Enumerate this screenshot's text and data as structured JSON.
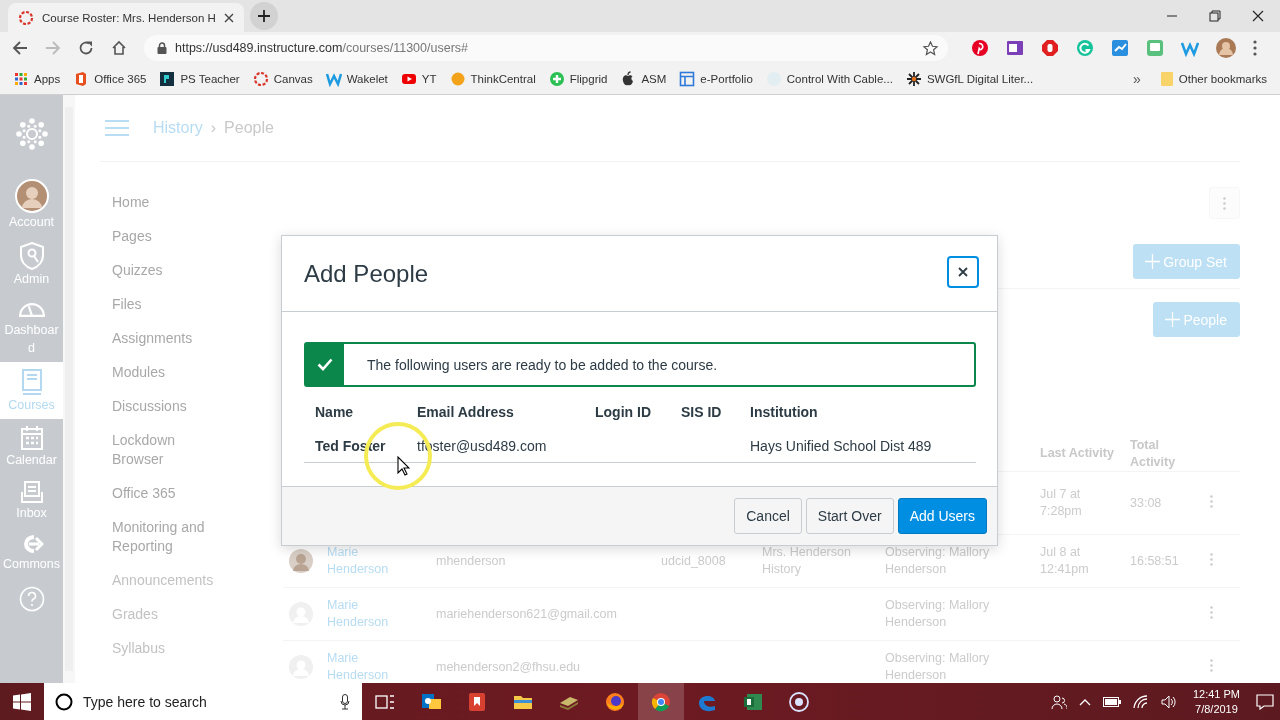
{
  "browser": {
    "tab_title": "Course Roster: Mrs. Henderson H",
    "url_host": "https://usd489.instructure.com",
    "url_path": "/courses/11300/users#",
    "bookmarks": [
      {
        "label": "Apps"
      },
      {
        "label": "Office 365"
      },
      {
        "label": "PS Teacher"
      },
      {
        "label": "Canvas"
      },
      {
        "label": "Wakelet"
      },
      {
        "label": "YT"
      },
      {
        "label": "ThinkCentral"
      },
      {
        "label": "Flipgrid"
      },
      {
        "label": "ASM"
      },
      {
        "label": "e-Portfolio"
      },
      {
        "label": "Control With Cable..."
      },
      {
        "label": "SWGfL Digital Liter..."
      }
    ],
    "overflow": "»",
    "other_bookmarks": "Other bookmarks"
  },
  "global_nav": [
    {
      "label": "Account",
      "selected": false
    },
    {
      "label": "Admin",
      "selected": false
    },
    {
      "label": "Dashboard",
      "selected": false
    },
    {
      "label": "Courses",
      "selected": true
    },
    {
      "label": "Calendar",
      "selected": false
    },
    {
      "label": "Inbox",
      "selected": false
    },
    {
      "label": "Commons",
      "selected": false
    }
  ],
  "breadcrumb": {
    "course": "History",
    "separator": "›",
    "page": "People"
  },
  "course_nav": [
    {
      "label": "Home",
      "hidden": false
    },
    {
      "label": "Pages",
      "hidden": false
    },
    {
      "label": "Quizzes",
      "hidden": false
    },
    {
      "label": "Files",
      "hidden": false
    },
    {
      "label": "Assignments",
      "hidden": false
    },
    {
      "label": "Modules",
      "hidden": false
    },
    {
      "label": "Discussions",
      "hidden": false
    },
    {
      "label": "Lockdown Browser",
      "hidden": false
    },
    {
      "label": "Office 365",
      "hidden": false
    },
    {
      "label": "Monitoring and Reporting",
      "hidden": false
    },
    {
      "label": "Announcements",
      "hidden": true
    },
    {
      "label": "Grades",
      "hidden": true
    },
    {
      "label": "Syllabus",
      "hidden": true
    }
  ],
  "actions": [
    {
      "label": "Group Set"
    },
    {
      "label": "People"
    }
  ],
  "roster": {
    "columns": [
      {
        "label": "Last Activity"
      },
      {
        "label": "Total Activity"
      }
    ],
    "rows": [
      {
        "last_activity": "Jul 7 at 7:28pm",
        "total_activity": "33:08"
      },
      {
        "kind": "photo",
        "name": "Marie Henderson",
        "login": "mhenderson",
        "sis_id": "udcid_8008",
        "section": "Mrs. Henderson History",
        "role": "Observing: Mallory Henderson",
        "last_activity": "Jul 8 at 12:41pm",
        "total_activity": "16:58:51"
      },
      {
        "kind": "default",
        "name": "Marie Henderson",
        "login": "mariehenderson621@gmail.com",
        "role": "Observing: Mallory Henderson"
      },
      {
        "kind": "default",
        "name": "Marie Henderson",
        "login": "mehenderson2@fhsu.edu",
        "role": "Observing: Mallory Henderson"
      }
    ]
  },
  "modal": {
    "title": "Add People",
    "alert": "The following users are ready to be added to the course.",
    "columns": [
      "Name",
      "Email Address",
      "Login ID",
      "SIS ID",
      "Institution"
    ],
    "users": [
      {
        "name": "Ted Foster",
        "email": "tfoster@usd489.com",
        "institution": "Hays Unified School Dist 489"
      }
    ],
    "buttons": [
      {
        "label": "Cancel",
        "kind": "default"
      },
      {
        "label": "Start Over",
        "kind": "default"
      },
      {
        "label": "Add Users",
        "kind": "primary"
      }
    ]
  },
  "taskbar": {
    "search_placeholder": "Type here to search",
    "apps": [
      {
        "selected": false
      },
      {
        "selected": false
      },
      {
        "selected": false
      },
      {
        "selected": false
      },
      {
        "selected": false
      },
      {
        "selected": true
      },
      {
        "selected": false
      },
      {
        "selected": false
      },
      {
        "selected": false
      }
    ],
    "time": "12:41 PM",
    "date": "7/8/2019"
  }
}
